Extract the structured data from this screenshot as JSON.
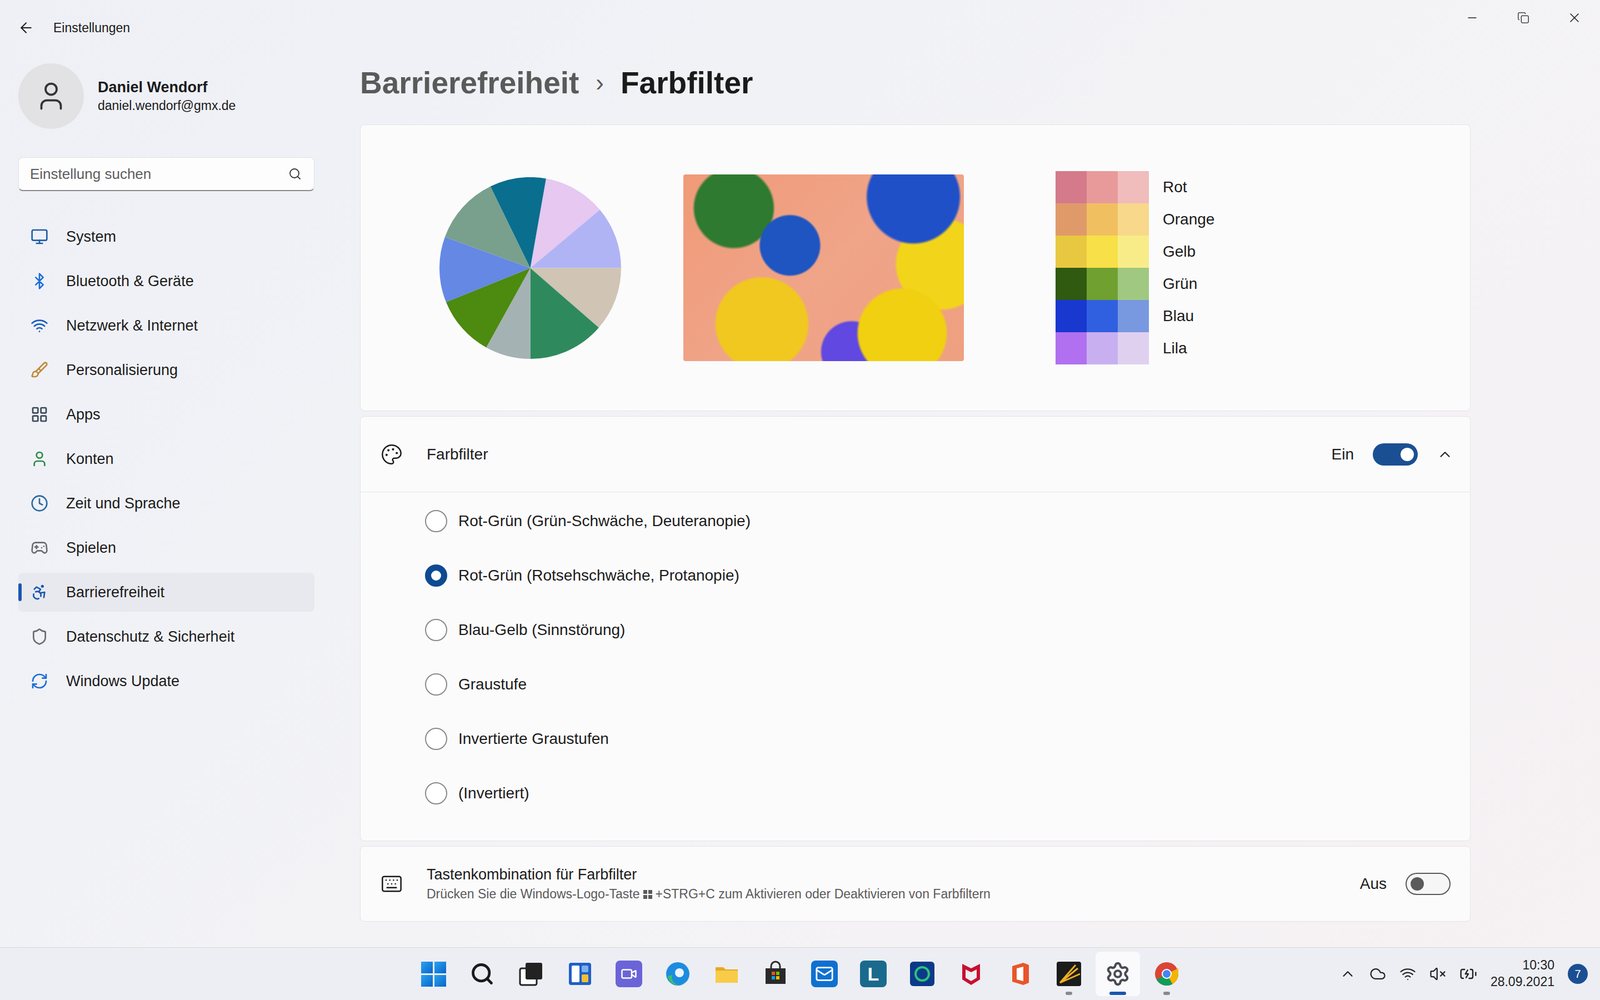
{
  "window": {
    "title": "Einstellungen"
  },
  "user": {
    "name": "Daniel Wendorf",
    "email": "daniel.wendorf@gmx.de"
  },
  "search": {
    "placeholder": "Einstellung suchen"
  },
  "sidebar": {
    "items": [
      {
        "label": "System",
        "selected": false
      },
      {
        "label": "Bluetooth & Geräte",
        "selected": false
      },
      {
        "label": "Netzwerk & Internet",
        "selected": false
      },
      {
        "label": "Personalisierung",
        "selected": false
      },
      {
        "label": "Apps",
        "selected": false
      },
      {
        "label": "Konten",
        "selected": false
      },
      {
        "label": "Zeit und Sprache",
        "selected": false
      },
      {
        "label": "Spielen",
        "selected": false
      },
      {
        "label": "Barrierefreiheit",
        "selected": true
      },
      {
        "label": "Datenschutz & Sicherheit",
        "selected": false
      },
      {
        "label": "Windows Update",
        "selected": false
      }
    ]
  },
  "breadcrumb": {
    "parent": "Barrierefreiheit",
    "separator": "›",
    "current": "Farbfilter"
  },
  "preview": {
    "pie": {
      "segments": [
        {
          "value": 40,
          "color": "#e6c8f0"
        },
        {
          "value": 40,
          "color": "#b0b4f4"
        },
        {
          "value": 41,
          "color": "#d0c4b4"
        },
        {
          "value": 49,
          "color": "#2e8a5c"
        },
        {
          "value": 29,
          "color": "#a4b2b4"
        },
        {
          "value": 39,
          "color": "#4c8a10"
        },
        {
          "value": 42,
          "color": "#6488e4"
        },
        {
          "value": 44,
          "color": "#78a08c"
        },
        {
          "value": 36,
          "color": "#0a6e8e"
        }
      ]
    },
    "swatches": [
      {
        "label": "Rot",
        "colors": [
          "#d47a8a",
          "#e89a9a",
          "#f0bcbc"
        ]
      },
      {
        "label": "Orange",
        "colors": [
          "#e09a6a",
          "#f0c060",
          "#f8d88a"
        ]
      },
      {
        "label": "Gelb",
        "colors": [
          "#e8c840",
          "#f8e048",
          "#f8ec88"
        ]
      },
      {
        "label": "Grün",
        "colors": [
          "#2f5a10",
          "#70a030",
          "#a0c880"
        ]
      },
      {
        "label": "Blau",
        "colors": [
          "#1838d0",
          "#3060e0",
          "#7898e0"
        ]
      },
      {
        "label": "Lila",
        "colors": [
          "#b070f0",
          "#c8b0f0",
          "#e0d0f0"
        ]
      }
    ]
  },
  "filter": {
    "label": "Farbfilter",
    "state_text": "Ein",
    "on": true,
    "expanded": true,
    "options": [
      {
        "label": "Rot-Grün (Grün-Schwäche, Deuteranopie)",
        "selected": false
      },
      {
        "label": "Rot-Grün (Rotsehschwäche, Protanopie)",
        "selected": true
      },
      {
        "label": "Blau-Gelb (Sinnstörung)",
        "selected": false
      },
      {
        "label": "Graustufe",
        "selected": false
      },
      {
        "label": "Invertierte Graustufen",
        "selected": false
      },
      {
        "label": "(Invertiert)",
        "selected": false
      }
    ]
  },
  "shortcut": {
    "title": "Tastenkombination für Farbfilter",
    "description_before": "Drücken Sie die Windows-Logo-Taste",
    "description_after": "+STRG+C zum Aktivieren oder Deaktivieren von Farbfiltern",
    "state_text": "Aus",
    "on": false
  },
  "taskbar": {
    "apps": [
      {
        "kind": "start",
        "running": false,
        "active": false
      },
      {
        "kind": "search",
        "running": false,
        "active": false
      },
      {
        "kind": "taskview",
        "running": false,
        "active": false
      },
      {
        "kind": "widgets",
        "running": false,
        "active": false
      },
      {
        "kind": "chat",
        "running": false,
        "active": false
      },
      {
        "kind": "edge",
        "running": false,
        "active": false
      },
      {
        "kind": "explorer",
        "running": false,
        "active": false
      },
      {
        "kind": "store",
        "running": false,
        "active": false
      },
      {
        "kind": "mail",
        "running": false,
        "active": false
      },
      {
        "kind": "letter",
        "label": "L",
        "running": false,
        "active": false
      },
      {
        "kind": "circle",
        "running": false,
        "active": false
      },
      {
        "kind": "mcafee",
        "running": false,
        "active": false
      },
      {
        "kind": "office",
        "running": false,
        "active": false
      },
      {
        "kind": "spark",
        "running": true,
        "active": false
      },
      {
        "kind": "settings",
        "running": true,
        "active": true
      },
      {
        "kind": "chrome",
        "running": true,
        "active": false
      }
    ],
    "tray": {
      "time": "10:30",
      "date": "28.09.2021",
      "badge": "7"
    }
  }
}
